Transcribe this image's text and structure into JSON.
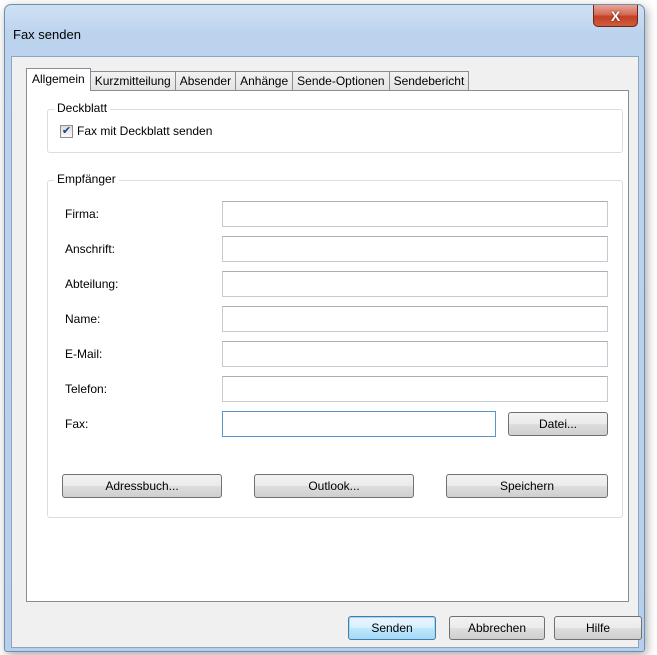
{
  "window": {
    "title": "Fax senden",
    "close_glyph": "X"
  },
  "tabs": [
    "Allgemein",
    "Kurzmitteilung",
    "Absender",
    "Anhänge",
    "Sende-Optionen",
    "Sendebericht"
  ],
  "deckblatt": {
    "group_label": "Deckblatt",
    "checkbox_label": "Fax mit Deckblatt senden",
    "checked": true
  },
  "empfaenger": {
    "group_label": "Empfänger",
    "fields": {
      "firma": {
        "label": "Firma:",
        "value": ""
      },
      "anschrift": {
        "label": "Anschrift:",
        "value": ""
      },
      "abteilung": {
        "label": "Abteilung:",
        "value": ""
      },
      "name": {
        "label": "Name:",
        "value": ""
      },
      "email": {
        "label": "E-Mail:",
        "value": ""
      },
      "telefon": {
        "label": "Telefon:",
        "value": ""
      },
      "fax": {
        "label": "Fax:",
        "value": ""
      }
    },
    "datei_button": "Datei...",
    "adressbuch_button": "Adressbuch...",
    "outlook_button": "Outlook...",
    "speichern_button": "Speichern"
  },
  "footer": {
    "senden_button": "Senden",
    "abbrechen_button": "Abbrechen",
    "hilfe_button": "Hilfe"
  }
}
